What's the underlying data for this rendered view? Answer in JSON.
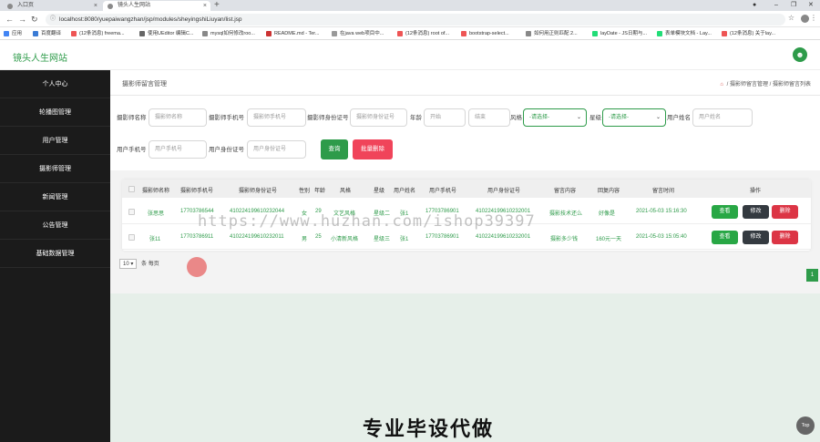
{
  "browser": {
    "tabs": [
      {
        "label": "入口页"
      },
      {
        "label": "镜头人生网站"
      }
    ],
    "url": "localhost:8080/yuepaiwangzhan/jsp/modules/sheyingshiLiuyan/list.jsp",
    "bookmarks": [
      "应用",
      "百度翻译",
      "(12条消息) freema...",
      "使用UEditor 编辑C...",
      "mysql如何修改roo...",
      "README.md - Ter...",
      "在java web项目中...",
      "(12条消息) root of...",
      "bootstrap-select...",
      "如何用正则匹配 2...",
      "layDate - JS日期与...",
      "表单模块文档 - Lay...",
      "(12条消息) 关于lay..."
    ]
  },
  "header": {
    "brand": "镜头人生网站"
  },
  "sidebar": {
    "items": [
      {
        "label": "个人中心"
      },
      {
        "label": "轮播图管理"
      },
      {
        "label": "用户管理"
      },
      {
        "label": "摄影师管理"
      },
      {
        "label": "新闻管理"
      },
      {
        "label": "公告管理"
      },
      {
        "label": "基础数据管理"
      }
    ]
  },
  "page": {
    "title": "摄影师留言管理",
    "breadcrumb": [
      "摄影师留言管理",
      "摄影师留言列表"
    ],
    "breadcrumb_sep": "/"
  },
  "search": {
    "labels": {
      "photographer_name": "摄影师名称",
      "photographer_phone": "摄影师手机号",
      "photographer_id": "摄影师身份证号",
      "age": "年龄",
      "style": "风格",
      "level": "星级",
      "user_name": "用户姓名",
      "user_phone": "用户手机号",
      "user_id": "用户身份证号"
    },
    "placeholders": {
      "photographer_name": "摄影师名称",
      "photographer_phone": "摄影师手机号",
      "photographer_id": "摄影师身份证号",
      "age_start": "开始",
      "age_end": "结束",
      "style": "-请选择-",
      "level": "-请选择-",
      "user_name": "用户姓名",
      "user_phone": "用户手机号",
      "user_id": "用户身份证号"
    },
    "query_button": "查询",
    "batch_delete_button": "批量删除"
  },
  "table": {
    "headers": [
      "摄影师名称",
      "摄影师手机号",
      "摄影师身份证号",
      "性别",
      "年龄",
      "风格",
      "星级",
      "用户姓名",
      "用户手机号",
      "用户身份证号",
      "留言内容",
      "回复内容",
      "留言时间",
      "操作"
    ],
    "rows": [
      {
        "name": "张思思",
        "phone": "17703786544",
        "id_card": "410224199610232044",
        "gender": "女",
        "age": "29",
        "style": "文艺风格",
        "level": "星级二",
        "user_name": "张1",
        "user_phone": "17703786901",
        "user_id_card": "410224199610232001",
        "message": "摄影技术还么",
        "reply": "好像是",
        "time": "2021-05-03 15:16:30"
      },
      {
        "name": "张11",
        "phone": "17703786911",
        "id_card": "410224199610232011",
        "gender": "男",
        "age": "25",
        "style": "小清新风格",
        "level": "星级三",
        "user_name": "张1",
        "user_phone": "17703786901",
        "user_id_card": "410224199610232001",
        "message": "摄影多少钱",
        "reply": "160元一天",
        "time": "2021-05-03 15:05:40"
      }
    ],
    "actions": {
      "view": "查看",
      "edit": "修改",
      "delete": "删除"
    }
  },
  "pager": {
    "page_size": "10",
    "page_size_suffix": "条 每页",
    "current_page": "1"
  },
  "overlay": {
    "watermark": "https://www.huzhan.com/ishop39397",
    "banner": "专业毕设代做",
    "top_button": "Top"
  },
  "colors": {
    "brand": "#2e9b4a",
    "sidebar": "#1b1b1b",
    "danger": "#dc3545",
    "dark": "#343a40"
  }
}
